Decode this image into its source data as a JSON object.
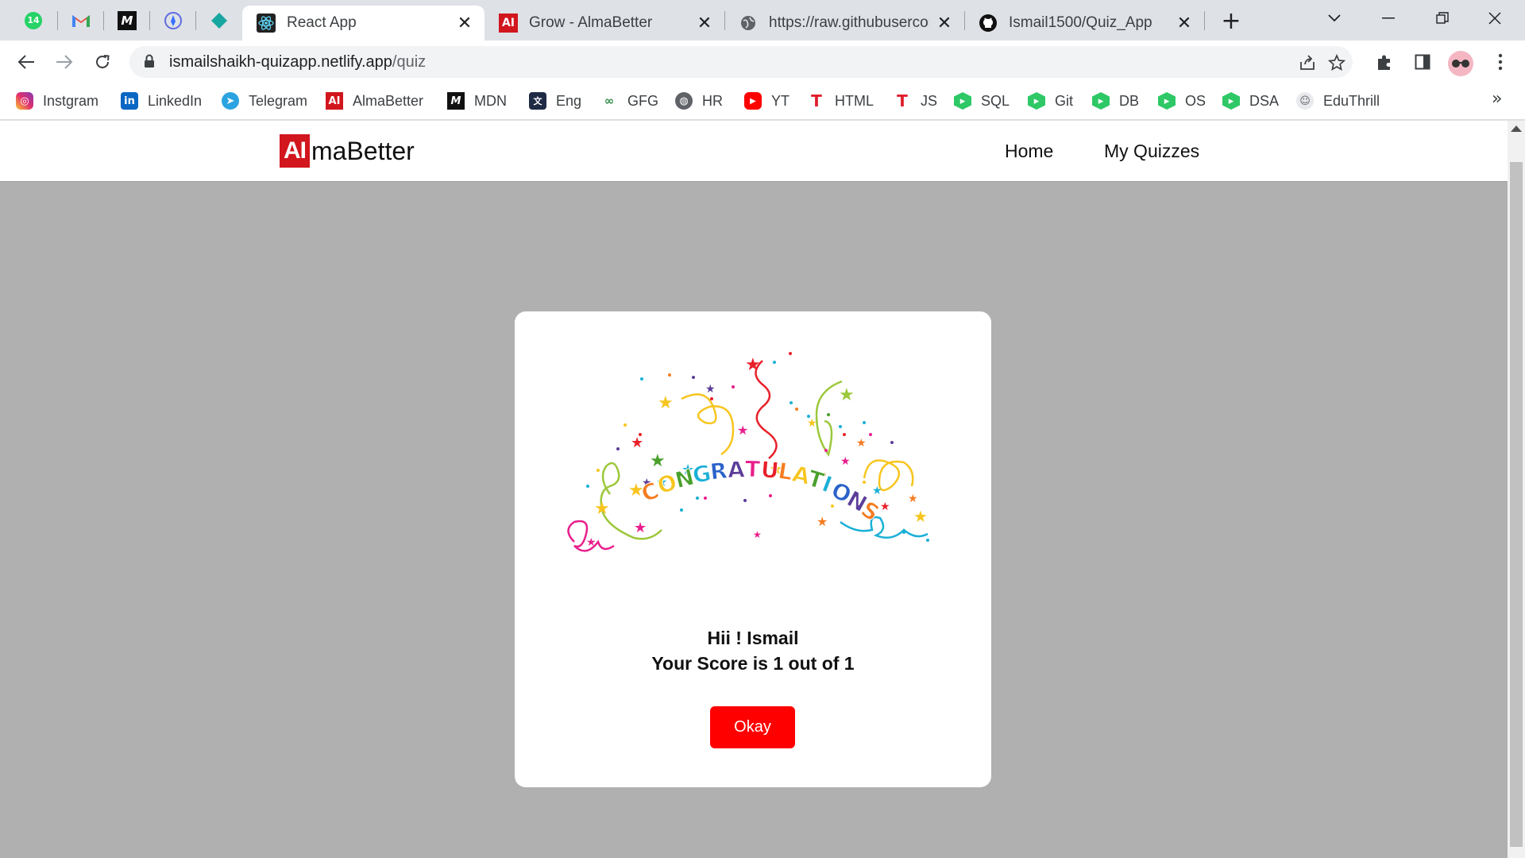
{
  "browser": {
    "pinned_tabs": [
      {
        "icon": "whatsapp-icon",
        "badge": "14"
      },
      {
        "icon": "gmail-icon"
      },
      {
        "icon": "mdn-icon"
      },
      {
        "icon": "devfolio-icon"
      },
      {
        "icon": "diamond-icon"
      }
    ],
    "tabs": [
      {
        "title": "React App",
        "icon": "react-icon",
        "active": true
      },
      {
        "title": "Grow - AlmaBetter",
        "icon": "almabetter-icon",
        "active": false
      },
      {
        "title": "https://raw.githubusercontent.com",
        "icon": "globe-icon",
        "active": false
      },
      {
        "title": "Ismail1500/Quiz_App",
        "icon": "github-icon",
        "active": false
      }
    ],
    "url": {
      "domain": "ismailshaikh-quizapp.netlify.app",
      "path": "/quiz"
    },
    "bookmarks": [
      {
        "label": "Instgram",
        "icon": "instagram-icon",
        "color": "#d6249f"
      },
      {
        "label": "LinkedIn",
        "icon": "linkedin-icon",
        "color": "#0a66c2"
      },
      {
        "label": "Telegram",
        "icon": "telegram-icon",
        "color": "#2aa3e0"
      },
      {
        "label": "AlmaBetter",
        "icon": "almabetter-icon",
        "color": "#d2161e"
      },
      {
        "label": "MDN",
        "icon": "mdn-icon",
        "color": "#111111"
      },
      {
        "label": "Eng",
        "icon": "translate-icon",
        "color": "#1f2a44"
      },
      {
        "label": "GFG",
        "icon": "gfg-icon",
        "color": "#2f8d46"
      },
      {
        "label": "HR",
        "icon": "globe-icon",
        "color": "#5f6368"
      },
      {
        "label": "YT",
        "icon": "youtube-icon",
        "color": "#ff0000"
      },
      {
        "label": "HTML",
        "icon": "tutorial-icon",
        "color": "#e01e2b"
      },
      {
        "label": "JS",
        "icon": "tutorial-icon",
        "color": "#e01e2b"
      },
      {
        "label": "SQL",
        "icon": "hexagon-icon",
        "color": "#2ec866"
      },
      {
        "label": "Git",
        "icon": "hexagon-icon",
        "color": "#2ec866"
      },
      {
        "label": "DB",
        "icon": "hexagon-icon",
        "color": "#2ec866"
      },
      {
        "label": "OS",
        "icon": "hexagon-icon",
        "color": "#2ec866"
      },
      {
        "label": "DSA",
        "icon": "hexagon-icon",
        "color": "#2ec866"
      },
      {
        "label": "EduThrill",
        "icon": "eduthrill-icon",
        "color": "#8a8f96"
      }
    ]
  },
  "site": {
    "logo": {
      "badge": "AI",
      "rest": "maBetter"
    },
    "nav": {
      "home": "Home",
      "quizzes": "My Quizzes"
    }
  },
  "result": {
    "banner_text": "CONGRATULATIONS",
    "greeting": "Hii ! Ismail",
    "score": "Your Score is 1 out of 1",
    "button": "Okay"
  },
  "colors": {
    "accent": "#ff0000",
    "brand": "#d2161e",
    "overlay": "#b0b0b0"
  }
}
